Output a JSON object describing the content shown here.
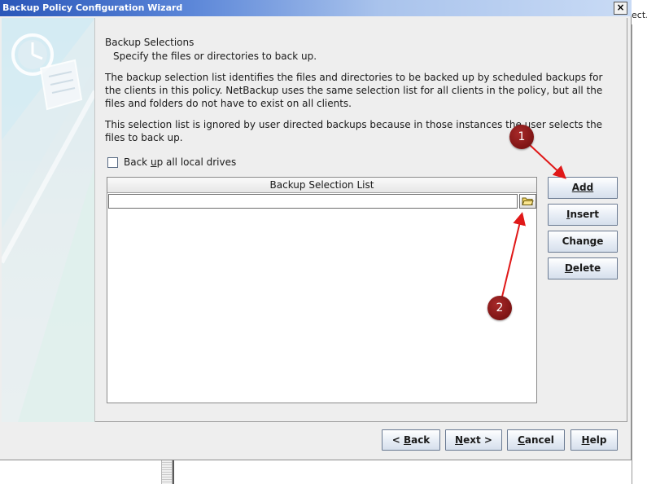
{
  "window": {
    "title": "Backup Policy Configuration Wizard",
    "close_glyph": "×",
    "background_text": "ect.s"
  },
  "page": {
    "heading": "Backup Selections",
    "subheading": "Specify the files or directories to back up.",
    "description1": "The backup selection list identifies the files and directories to be backed up by scheduled backups for the clients in this policy. NetBackup uses the same selection list for all clients in the policy, but all the files and folders do not have to exist on all clients.",
    "description2": "This selection list is ignored by user directed backups because in those instances the user selects the files to back up."
  },
  "checkbox": {
    "label_pre": "Back ",
    "label_mn": "u",
    "label_post": "p all local drives",
    "checked": false
  },
  "list": {
    "header": "Backup Selection List",
    "path_value": ""
  },
  "buttons": {
    "add": {
      "mn": "A",
      "rest": "dd"
    },
    "insert": {
      "mn": "I",
      "rest": "nsert"
    },
    "change": {
      "pre": "Chan",
      "mn": "g",
      "post": "e"
    },
    "delete": {
      "mn": "D",
      "rest": "elete"
    }
  },
  "footer": {
    "back": {
      "pre": "< ",
      "mn": "B",
      "post": "ack"
    },
    "next": {
      "mn": "N",
      "post": "ext >"
    },
    "cancel": {
      "mn": "C",
      "post": "ancel"
    },
    "help": {
      "mn": "H",
      "post": "elp"
    }
  },
  "annotations": {
    "marker1": "1",
    "marker2": "2",
    "marker_color": "#7a1010",
    "arrow_color": "#e01818"
  },
  "icons": {
    "clock": "clock-icon",
    "document": "document-icon",
    "folder": "folder-icon",
    "close": "close-icon"
  }
}
